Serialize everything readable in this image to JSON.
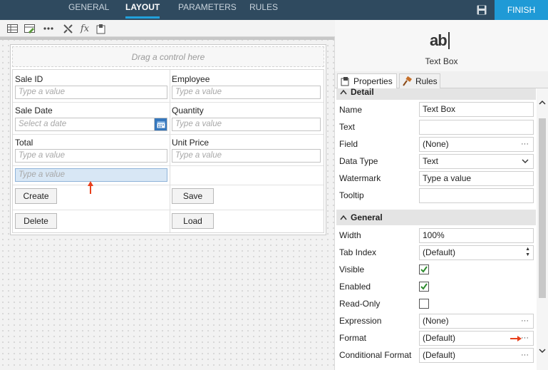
{
  "topnav": {
    "tabs": [
      {
        "label": "GENERAL"
      },
      {
        "label": "LAYOUT"
      },
      {
        "label": "PARAMETERS"
      },
      {
        "label": "RULES"
      }
    ],
    "finish_label": "FINISH"
  },
  "toolbar": {
    "icons": [
      "table-icon",
      "edit-table-icon",
      "more-icon",
      "tools-icon",
      "function-icon",
      "theme-icon"
    ],
    "fx_label": "fx"
  },
  "canvas": {
    "drag_hint": "Drag a control here",
    "fields": {
      "sale_id": {
        "label": "Sale ID",
        "placeholder": "Type a value"
      },
      "employee": {
        "label": "Employee",
        "placeholder": "Type a value"
      },
      "sale_date": {
        "label": "Sale Date",
        "placeholder": "Select a date"
      },
      "quantity": {
        "label": "Quantity",
        "placeholder": "Type a value"
      },
      "total": {
        "label": "Total",
        "placeholder": "Type a value"
      },
      "unit_price": {
        "label": "Unit Price",
        "placeholder": "Type a value"
      },
      "new_textbox": {
        "placeholder": "Type a value"
      }
    },
    "buttons": {
      "create": "Create",
      "save": "Save",
      "delete": "Delete",
      "load": "Load"
    }
  },
  "panel": {
    "control_icon_text": "ab",
    "control_name": "Text Box",
    "tabs": {
      "properties": "Properties",
      "rules": "Rules"
    },
    "detail": {
      "title": "Detail",
      "rows": [
        {
          "label": "Name",
          "value": "Text Box"
        },
        {
          "label": "Text",
          "value": ""
        },
        {
          "label": "Field",
          "value": "(None)"
        },
        {
          "label": "Data Type",
          "value": "Text"
        },
        {
          "label": "Watermark",
          "value": "Type a value"
        },
        {
          "label": "Tooltip",
          "value": ""
        }
      ]
    },
    "general": {
      "title": "General",
      "rows": [
        {
          "label": "Width",
          "value": "100%"
        },
        {
          "label": "Tab Index",
          "value": "(Default)"
        },
        {
          "label": "Visible",
          "checked": true
        },
        {
          "label": "Enabled",
          "checked": true
        },
        {
          "label": "Read-Only",
          "checked": false
        },
        {
          "label": "Expression",
          "value": "(None)"
        },
        {
          "label": "Format",
          "value": "(Default)"
        },
        {
          "label": "Conditional Format",
          "value": "(Default)"
        }
      ]
    },
    "ellipsis": "···"
  },
  "colors": {
    "topbar": "#2f4a5f",
    "accent": "#1f9ad6",
    "annotation_arrow": "#e8401c"
  }
}
